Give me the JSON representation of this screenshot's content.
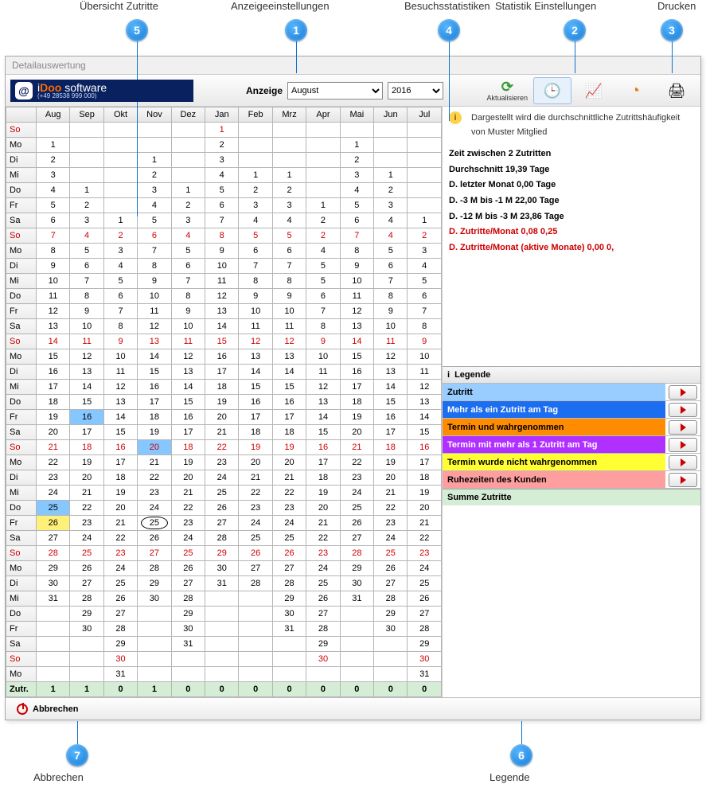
{
  "annotations": {
    "a1": "Anzeigeeinstellungen",
    "a2": "Statistik Einstellungen",
    "a3": "Drucken",
    "a4": "Besuchsstatistiken",
    "a5": "Übersicht Zutritte",
    "a6": "Legende",
    "a7": "Abbrechen"
  },
  "window": {
    "title": "Detailauswertung"
  },
  "logo": {
    "brand_prefix": "i",
    "brand_highlight": "Doo",
    "brand_suffix": "  software",
    "phone": "(+49 28538 999 000)",
    "symbol": "@"
  },
  "header": {
    "anzeige_label": "Anzeige",
    "month_selected": "August",
    "year_selected": "2016",
    "btn_refresh": "Aktualisieren"
  },
  "grid": {
    "dow_hdr": "",
    "months": [
      "Aug",
      "Sep",
      "Okt",
      "Nov",
      "Dez",
      "Jan",
      "Feb",
      "Mrz",
      "Apr",
      "Mai",
      "Jun",
      "Jul"
    ],
    "day_labels": [
      "So",
      "Mo",
      "Di",
      "Mi",
      "Do",
      "Fr",
      "Sa"
    ],
    "total_label": "Zutr.",
    "totals": [
      "1",
      "1",
      "0",
      "1",
      "0",
      "0",
      "0",
      "0",
      "0",
      "0",
      "0",
      "0"
    ],
    "rows": [
      {
        "dow": "So",
        "sun": true,
        "cells": [
          "",
          "",
          "",
          "",
          "",
          "1",
          "",
          "",
          "",
          "",
          "",
          ""
        ]
      },
      {
        "dow": "Mo",
        "cells": [
          "1",
          "",
          "",
          "",
          "",
          "2",
          "",
          "",
          "",
          "1",
          "",
          ""
        ]
      },
      {
        "dow": "Di",
        "cells": [
          "2",
          "",
          "",
          "1",
          "",
          "3",
          "",
          "",
          "",
          "2",
          "",
          ""
        ]
      },
      {
        "dow": "Mi",
        "cells": [
          "3",
          "",
          "",
          "2",
          "",
          "4",
          "1",
          "1",
          "",
          "3",
          "1",
          ""
        ]
      },
      {
        "dow": "Do",
        "cells": [
          "4",
          "1",
          "",
          "3",
          "1",
          "5",
          "2",
          "2",
          "",
          "4",
          "2",
          ""
        ]
      },
      {
        "dow": "Fr",
        "cells": [
          "5",
          "2",
          "",
          "4",
          "2",
          "6",
          "3",
          "3",
          "1",
          "5",
          "3",
          ""
        ]
      },
      {
        "dow": "Sa",
        "cells": [
          "6",
          "3",
          "1",
          "5",
          "3",
          "7",
          "4",
          "4",
          "2",
          "6",
          "4",
          "1"
        ]
      },
      {
        "dow": "So",
        "sun": true,
        "cells": [
          "7",
          "4",
          "2",
          "6",
          "4",
          "8",
          "5",
          "5",
          "2",
          "7",
          "4",
          "2"
        ]
      },
      {
        "dow": "Mo",
        "cells": [
          "8",
          "5",
          "3",
          "7",
          "5",
          "9",
          "6",
          "6",
          "4",
          "8",
          "5",
          "3"
        ]
      },
      {
        "dow": "Di",
        "cells": [
          "9",
          "6",
          "4",
          "8",
          "6",
          "10",
          "7",
          "7",
          "5",
          "9",
          "6",
          "4"
        ]
      },
      {
        "dow": "Mi",
        "cells": [
          "10",
          "7",
          "5",
          "9",
          "7",
          "11",
          "8",
          "8",
          "5",
          "10",
          "7",
          "5"
        ]
      },
      {
        "dow": "Do",
        "cells": [
          "11",
          "8",
          "6",
          "10",
          "8",
          "12",
          "9",
          "9",
          "6",
          "11",
          "8",
          "6"
        ]
      },
      {
        "dow": "Fr",
        "cells": [
          "12",
          "9",
          "7",
          "11",
          "9",
          "13",
          "10",
          "10",
          "7",
          "12",
          "9",
          "7"
        ]
      },
      {
        "dow": "Sa",
        "cells": [
          "13",
          "10",
          "8",
          "12",
          "10",
          "14",
          "11",
          "11",
          "8",
          "13",
          "10",
          "8"
        ]
      },
      {
        "dow": "So",
        "sun": true,
        "cells": [
          "14",
          "11",
          "9",
          "13",
          "11",
          "15",
          "12",
          "12",
          "9",
          "14",
          "11",
          "9"
        ]
      },
      {
        "dow": "Mo",
        "cells": [
          "15",
          "12",
          "10",
          "14",
          "12",
          "16",
          "13",
          "13",
          "10",
          "15",
          "12",
          "10"
        ]
      },
      {
        "dow": "Di",
        "cells": [
          "16",
          "13",
          "11",
          "15",
          "13",
          "17",
          "14",
          "14",
          "11",
          "16",
          "13",
          "11"
        ]
      },
      {
        "dow": "Mi",
        "cells": [
          "17",
          "14",
          "12",
          "16",
          "14",
          "18",
          "15",
          "15",
          "12",
          "17",
          "14",
          "12"
        ]
      },
      {
        "dow": "Do",
        "cells": [
          "18",
          "15",
          "13",
          "17",
          "15",
          "19",
          "16",
          "16",
          "13",
          "18",
          "15",
          "13"
        ]
      },
      {
        "dow": "Fr",
        "cells": [
          "19",
          "16",
          "14",
          "18",
          "16",
          "20",
          "17",
          "17",
          "14",
          "19",
          "16",
          "14"
        ],
        "hl": [
          {
            "c": 1,
            "t": "blue"
          }
        ]
      },
      {
        "dow": "Sa",
        "cells": [
          "20",
          "17",
          "15",
          "19",
          "17",
          "21",
          "18",
          "18",
          "15",
          "20",
          "17",
          "15"
        ]
      },
      {
        "dow": "So",
        "sun": true,
        "cells": [
          "21",
          "18",
          "16",
          "20",
          "18",
          "22",
          "19",
          "19",
          "16",
          "21",
          "18",
          "16"
        ],
        "hl": [
          {
            "c": 3,
            "t": "blue"
          }
        ]
      },
      {
        "dow": "Mo",
        "cells": [
          "22",
          "19",
          "17",
          "21",
          "19",
          "23",
          "20",
          "20",
          "17",
          "22",
          "19",
          "17"
        ]
      },
      {
        "dow": "Di",
        "cells": [
          "23",
          "20",
          "18",
          "22",
          "20",
          "24",
          "21",
          "21",
          "18",
          "23",
          "20",
          "18"
        ]
      },
      {
        "dow": "Mi",
        "cells": [
          "24",
          "21",
          "19",
          "23",
          "21",
          "25",
          "22",
          "22",
          "19",
          "24",
          "21",
          "19"
        ]
      },
      {
        "dow": "Do",
        "cells": [
          "25",
          "22",
          "20",
          "24",
          "22",
          "26",
          "23",
          "23",
          "20",
          "25",
          "22",
          "20"
        ],
        "hl": [
          {
            "c": 0,
            "t": "blue"
          }
        ]
      },
      {
        "dow": "Fr",
        "cells": [
          "26",
          "23",
          "21",
          "25",
          "23",
          "27",
          "24",
          "24",
          "21",
          "26",
          "23",
          "21"
        ],
        "hl": [
          {
            "c": 0,
            "t": "yellow"
          },
          {
            "c": 3,
            "t": "oval"
          }
        ]
      },
      {
        "dow": "Sa",
        "cells": [
          "27",
          "24",
          "22",
          "26",
          "24",
          "28",
          "25",
          "25",
          "22",
          "27",
          "24",
          "22"
        ]
      },
      {
        "dow": "So",
        "sun": true,
        "cells": [
          "28",
          "25",
          "23",
          "27",
          "25",
          "29",
          "26",
          "26",
          "23",
          "28",
          "25",
          "23"
        ]
      },
      {
        "dow": "Mo",
        "cells": [
          "29",
          "26",
          "24",
          "28",
          "26",
          "30",
          "27",
          "27",
          "24",
          "29",
          "26",
          "24"
        ]
      },
      {
        "dow": "Di",
        "cells": [
          "30",
          "27",
          "25",
          "29",
          "27",
          "31",
          "28",
          "28",
          "25",
          "30",
          "27",
          "25"
        ]
      },
      {
        "dow": "Mi",
        "cells": [
          "31",
          "28",
          "26",
          "30",
          "28",
          "",
          "",
          "29",
          "26",
          "31",
          "28",
          "26"
        ]
      },
      {
        "dow": "Do",
        "cells": [
          "",
          "29",
          "27",
          "",
          "29",
          "",
          "",
          "30",
          "27",
          "",
          "29",
          "27"
        ]
      },
      {
        "dow": "Fr",
        "cells": [
          "",
          "30",
          "28",
          "",
          "30",
          "",
          "",
          "31",
          "28",
          "",
          "30",
          "28"
        ]
      },
      {
        "dow": "Sa",
        "cells": [
          "",
          "",
          "29",
          "",
          "31",
          "",
          "",
          "",
          "29",
          "",
          "",
          "29"
        ]
      },
      {
        "dow": "So",
        "sun": true,
        "cells": [
          "",
          "",
          "30",
          "",
          "",
          "",
          "",
          "",
          "30",
          "",
          "",
          "30"
        ]
      },
      {
        "dow": "Mo",
        "cells": [
          "",
          "",
          "31",
          "",
          "",
          "",
          "",
          "",
          "",
          "",
          "",
          "31"
        ]
      }
    ]
  },
  "side": {
    "intro": "Dargestellt wird die durchschnittliche Zutrittshäufigkeit von Muster Mitglied",
    "stats": [
      {
        "t": "Zeit zwischen 2 Zutritten"
      },
      {
        "t": "Durchschnitt 19,39 Tage"
      },
      {
        "t": "D. letzter Monat 0,00 Tage"
      },
      {
        "t": "D. -3 M bis -1 M 22,00 Tage"
      },
      {
        "t": "D. -12 M bis -3 M 23,86 Tage"
      },
      {
        "t": "D. Zutritte/Monat 0,08 0,25",
        "red": true
      },
      {
        "t": "D. Zutritte/Monat (aktive Monate) 0,00 0,",
        "red": true
      }
    ]
  },
  "legend": {
    "title": "Legende",
    "items": [
      "Zutritt",
      "Mehr als ein Zutritt am Tag",
      "Termin und wahrgenommen",
      "Termin mit mehr als 1 Zutritt am Tag",
      "Termin wurde nicht wahrgenommen",
      "Ruhezeiten des Kunden"
    ],
    "sum": "Summe Zutritte"
  },
  "bottom": {
    "cancel": "Abbrechen"
  }
}
